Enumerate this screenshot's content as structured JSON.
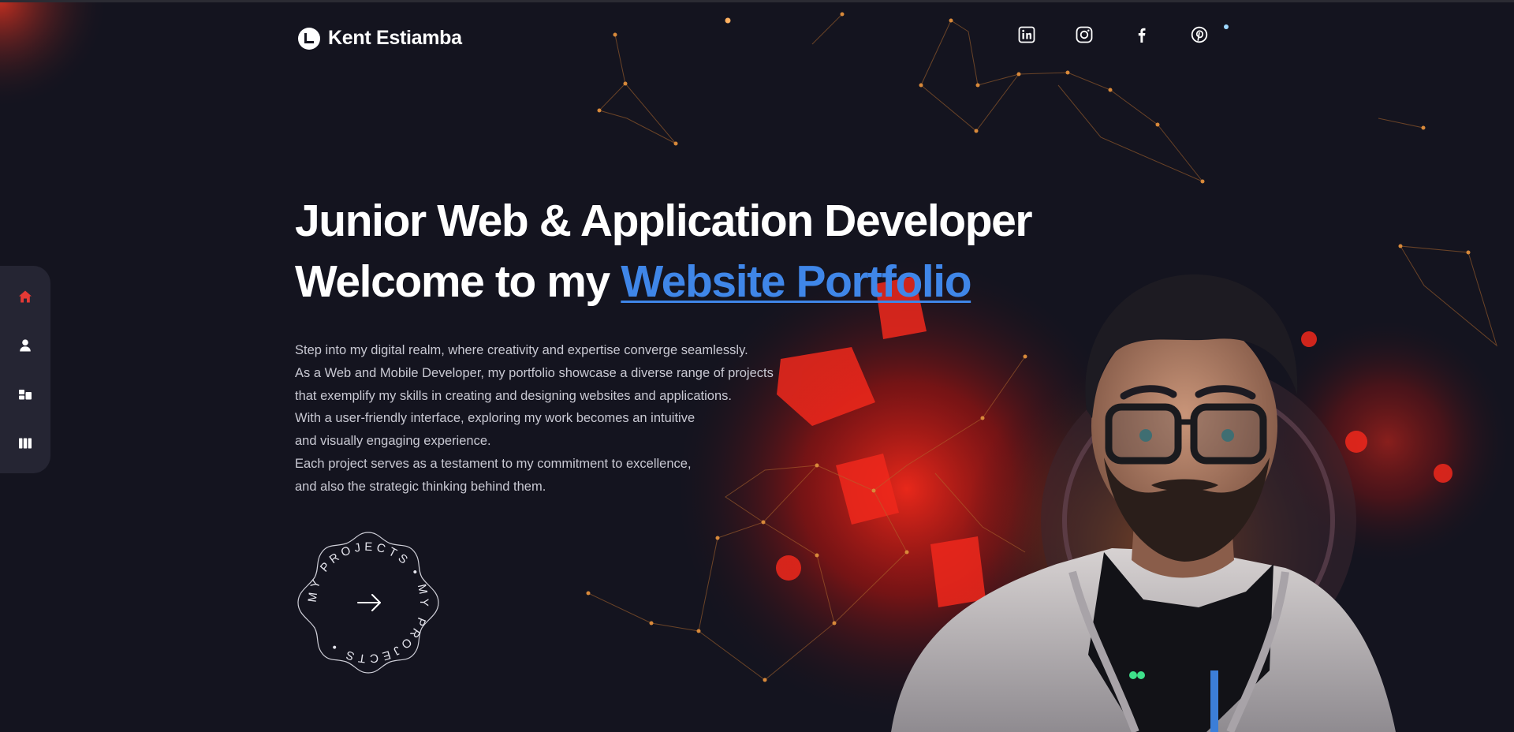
{
  "brand": {
    "name": "Kent Estiamba"
  },
  "socials": [
    {
      "icon": "linkedin-icon"
    },
    {
      "icon": "instagram-icon"
    },
    {
      "icon": "facebook-icon"
    },
    {
      "icon": "pinterest-icon"
    }
  ],
  "sidenav": [
    {
      "icon": "home-icon",
      "active": true
    },
    {
      "icon": "user-icon",
      "active": false
    },
    {
      "icon": "projects-icon",
      "active": false
    },
    {
      "icon": "library-icon",
      "active": false
    }
  ],
  "hero": {
    "line1": "Junior Web & Application Developer",
    "line2_prefix": "Welcome to my ",
    "line2_accent": "Website Portfolio"
  },
  "description": [
    "Step into my digital realm, where creativity and expertise converge seamlessly.",
    "As a Web and Mobile Developer, my portfolio showcase a diverse range of projects",
    "that exemplify my skills in creating and designing websites and applications.",
    "With a user-friendly interface, exploring my work becomes an intuitive",
    "and visually engaging experience.",
    "Each project serves as a testament to my commitment to excellence,",
    "and also the strategic thinking behind them."
  ],
  "cta": {
    "ring_text": "MY PROJECTS • MY PROJECTS •",
    "icon": "arrow-right-icon"
  },
  "colors": {
    "accent": "#3f86e8",
    "active_nav": "#e53935",
    "background": "#14141f",
    "sidenav_bg": "#252533"
  }
}
